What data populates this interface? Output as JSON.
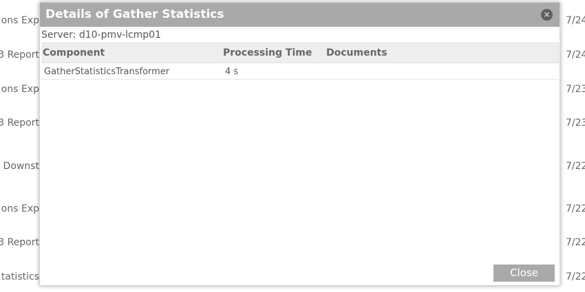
{
  "background_list": {
    "names": [
      "ons Exp",
      "3 Report",
      "ons Exp",
      "3 Report",
      " Downst",
      "ons Exp",
      "3 Report",
      "tatistics"
    ],
    "dates": [
      "7/24",
      "7/24",
      "7/23",
      "7/23",
      "7/22",
      "7/22",
      "7/22",
      "7/22"
    ]
  },
  "dialog": {
    "title": "Details of Gather Statistics",
    "close_icon": "close-circle-icon",
    "server_label": "Server: d10-pmv-lcmp01",
    "table": {
      "headers": {
        "component": "Component",
        "processing_time": "Processing Time",
        "documents": "Documents"
      },
      "rows": [
        {
          "component": "GatherStatisticsTransformer",
          "processing_time": "4 s",
          "documents": ""
        }
      ]
    },
    "close_button_label": "Close"
  },
  "colors": {
    "header_bg": "#a9a9a9",
    "button_bg": "#a9a9a9",
    "table_header_bg": "#eeeeee"
  }
}
